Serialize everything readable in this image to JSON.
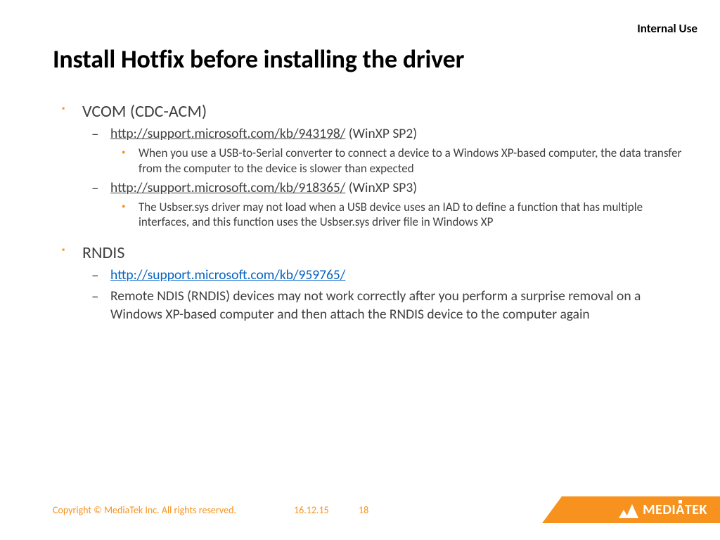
{
  "classification": "Internal Use",
  "title": "Install Hotfix before installing the driver",
  "content": {
    "sections": [
      {
        "heading": "VCOM (CDC-ACM)",
        "items": [
          {
            "link": "http://support.microsoft.com/kb/943198/",
            "suffix": " (WinXP SP2)",
            "detail": "When you use a USB-to-Serial converter to connect a device to a Windows XP-based computer, the data transfer from the computer to the device is slower than expected"
          },
          {
            "link": "http://support.microsoft.com/kb/918365/",
            "suffix": " (WinXP SP3)",
            "detail": "The Usbser.sys driver may not load when a USB device uses an IAD to define a function that has multiple interfaces, and this function uses the Usbser.sys driver file in Windows XP"
          }
        ]
      },
      {
        "heading": "RNDIS",
        "items": [
          {
            "hlink": "http://support.microsoft.com/kb/959765/"
          },
          {
            "text": "Remote NDIS (RNDIS) devices may not work correctly after you perform a surprise removal on a Windows XP-based computer and then attach the RNDIS device to the computer again"
          }
        ]
      }
    ]
  },
  "footer": {
    "copyright": "Copyright © MediaTek Inc. All rights reserved.",
    "date": "16.12.15",
    "page": "18",
    "brand_pre": "MEDI",
    "brand_post": "TEK"
  }
}
